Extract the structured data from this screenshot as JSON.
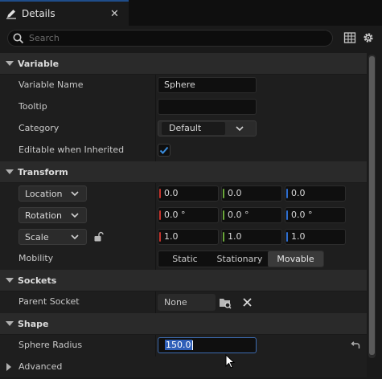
{
  "tab": {
    "title": "Details",
    "close": "✕"
  },
  "search": {
    "placeholder": "Search"
  },
  "sections": {
    "variable": "Variable",
    "transform": "Transform",
    "sockets": "Sockets",
    "shape": "Shape",
    "advanced": "Advanced"
  },
  "variable": {
    "name_label": "Variable Name",
    "name_value": "Sphere",
    "tooltip_label": "Tooltip",
    "tooltip_value": "",
    "category_label": "Category",
    "category_value": "Default",
    "editable_label": "Editable when Inherited",
    "editable_checked": true
  },
  "transform": {
    "location": {
      "label": "Location",
      "x": "0.0",
      "y": "0.0",
      "z": "0.0"
    },
    "rotation": {
      "label": "Rotation",
      "x": "0.0 °",
      "y": "0.0 °",
      "z": "0.0 °"
    },
    "scale": {
      "label": "Scale",
      "x": "1.0",
      "y": "1.0",
      "z": "1.0"
    },
    "mobility_label": "Mobility",
    "mobility_options": [
      "Static",
      "Stationary",
      "Movable"
    ],
    "mobility_selected": "Movable"
  },
  "sockets": {
    "parent_label": "Parent Socket",
    "parent_value": "None"
  },
  "shape": {
    "radius_label": "Sphere Radius",
    "radius_value": "150.0"
  },
  "colors": {
    "accent": "#1f4d8a",
    "check": "#3a8dde",
    "x_axis": "#c4342d",
    "y_axis": "#6aa63a",
    "z_axis": "#2f6fd0"
  }
}
